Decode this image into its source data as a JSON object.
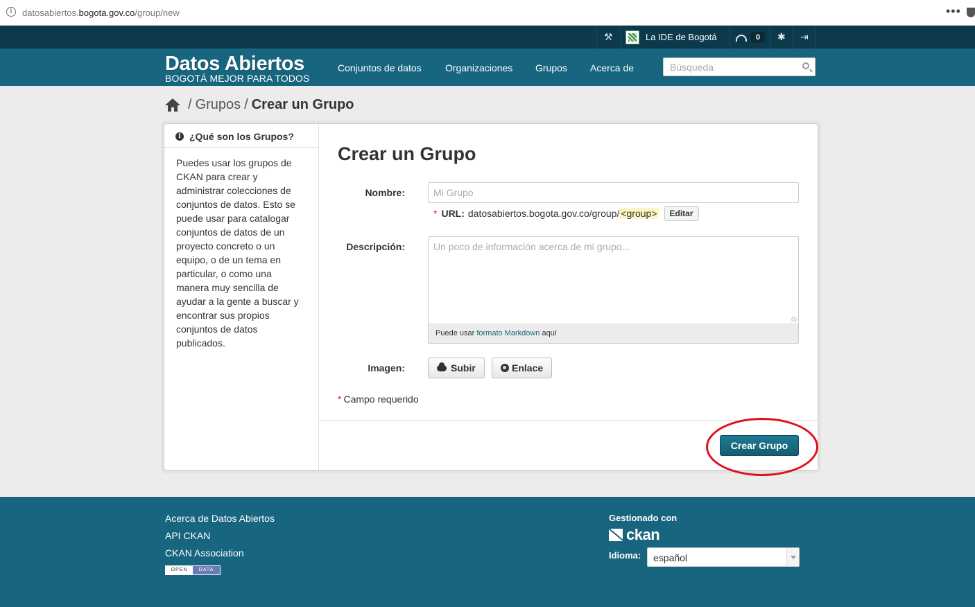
{
  "browser": {
    "url_prefix": "datosabiertos.",
    "url_domain": "bogota.gov.co",
    "url_path": "/group/new"
  },
  "account": {
    "site_name": "La IDE de Bogotá",
    "dashboard_count": "0"
  },
  "header": {
    "brand_title": "Datos Abiertos",
    "brand_tagline": "BOGOTÁ MEJOR PARA TODOS",
    "nav": [
      "Conjuntos de datos",
      "Organizaciones",
      "Grupos",
      "Acerca de"
    ],
    "search_placeholder": "Búsqueda"
  },
  "breadcrumb": {
    "sep": "/",
    "groups": "Grupos",
    "current": "Crear un Grupo"
  },
  "sidebar": {
    "title": "¿Qué son los Grupos?",
    "body": "Puedes usar los grupos de CKAN para crear y administrar colecciones de conjuntos de datos. Esto se puede usar para catalogar conjuntos de datos de un proyecto concreto o un equipo, o de un tema en particular, o como una manera muy sencilla de ayudar a la gente a buscar y encontrar sus propios conjuntos de datos publicados."
  },
  "form": {
    "heading": "Crear un Grupo",
    "name_label": "Nombre:",
    "name_placeholder": "Mi Grupo",
    "required_mark": "*",
    "url_label": "URL:",
    "url_prefix": "datosabiertos.bogota.gov.co/group/",
    "url_slug": "<group>",
    "edit_button": "Editar",
    "description_label": "Descripción:",
    "description_placeholder": "Un poco de información acerca de mi grupo...",
    "markdown_prefix": "Puede usar ",
    "markdown_link": "formato Markdown",
    "markdown_suffix": " aquí",
    "image_label": "Imagen:",
    "upload_button": "Subir",
    "link_button": "Enlace",
    "required_note": "Campo requerido",
    "submit_button": "Crear Grupo"
  },
  "footer": {
    "links": [
      "Acerca de Datos Abiertos",
      "API CKAN",
      "CKAN Association"
    ],
    "open_data_a": "OPEN",
    "open_data_b": "DATA",
    "powered_by": "Gestionado con",
    "ckan_logo": "ckan",
    "language_label": "Idioma:",
    "language_value": "español"
  },
  "colors": {
    "masthead": "#17657e",
    "account_bar": "#0c3a4c",
    "annotation_circle": "#e0101c"
  }
}
